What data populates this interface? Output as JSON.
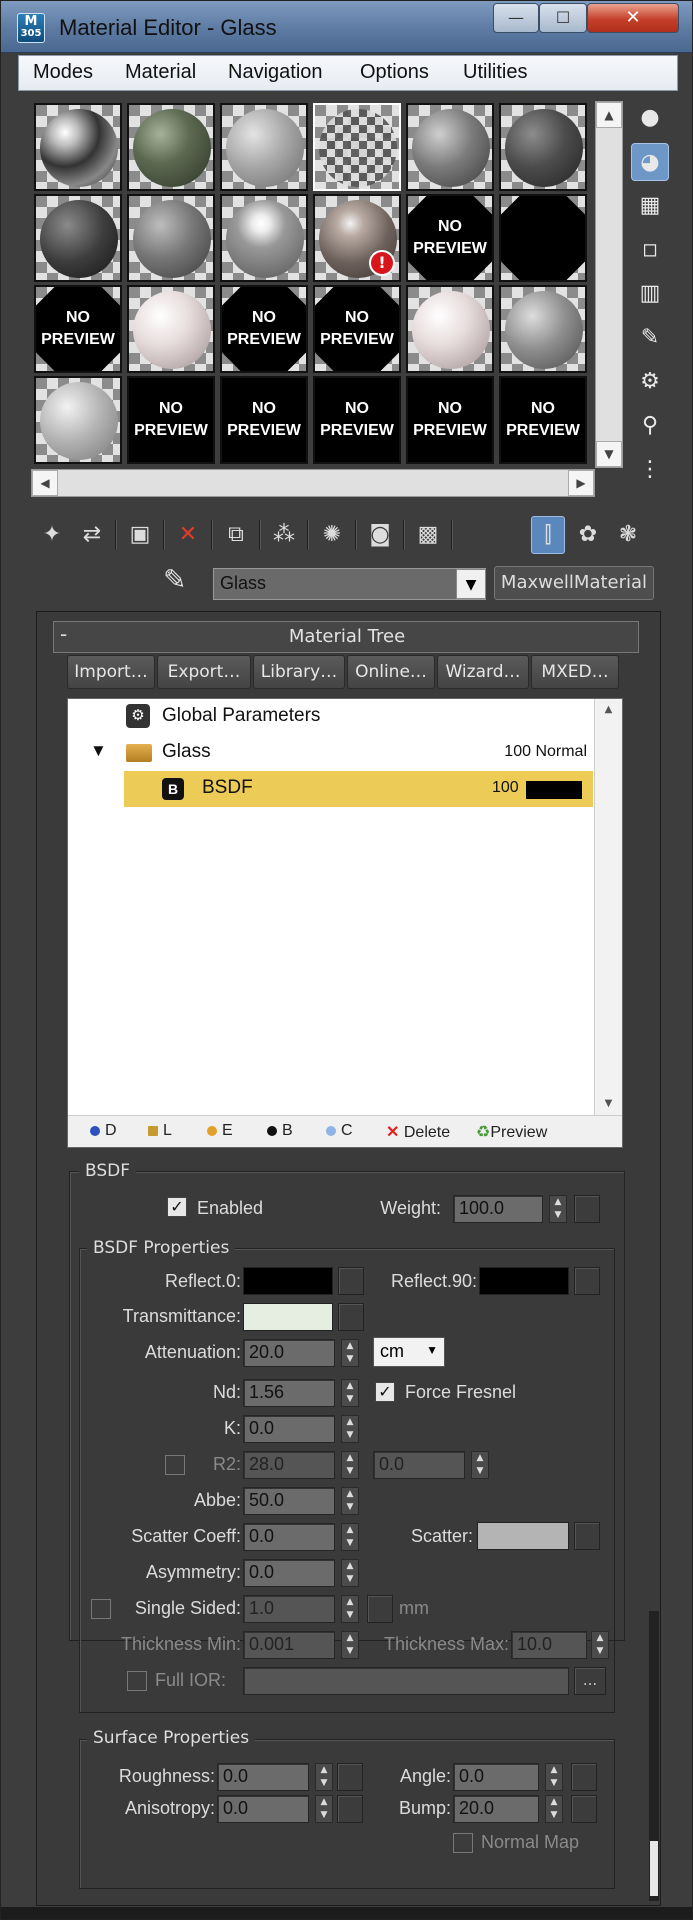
{
  "window": {
    "title": "Material Editor - Glass",
    "icon_text_top": "M",
    "icon_text_bottom": "305",
    "min": "—",
    "max": "☐",
    "close": "✕"
  },
  "menubar": [
    "Modes",
    "Material",
    "Navigation",
    "Options",
    "Utilities"
  ],
  "slots": {
    "no_preview_line1": "NO",
    "no_preview_line2": "PREVIEW",
    "warning_glyph": "!",
    "sample_types": [
      [
        "chrome-sphere",
        "green-sphere",
        "gray-sphere",
        "checker-sphere",
        "speckled-sphere",
        "dark-sphere"
      ],
      [
        "dark-checker-sphere",
        "noise-sphere",
        "checker-sphere",
        "warning-sphere",
        "no-preview-octagon",
        "black-octagon"
      ],
      [
        "no-preview-octagon",
        "map-sphere",
        "no-preview-octagon",
        "no-preview-octagon",
        "map-sphere",
        "noise-sphere"
      ],
      [
        "gray-sphere",
        "no-preview-square",
        "no-preview-square",
        "no-preview-square",
        "no-preview-square",
        "no-preview-square"
      ]
    ]
  },
  "material_selector": {
    "name": "Glass",
    "type_button": "MaxwellMaterial"
  },
  "material_tree": {
    "header": "Material Tree",
    "collapse": "-",
    "buttons": [
      "Import…",
      "Export…",
      "Library…",
      "Online…",
      "Wizard…",
      "MXED…"
    ],
    "rows": [
      {
        "label": "Global Parameters",
        "value": ""
      },
      {
        "label": "Glass",
        "value": "100 Normal",
        "expand": "▼"
      },
      {
        "label": "BSDF",
        "value": "100",
        "badge": "B"
      }
    ],
    "footer": [
      {
        "label": "D",
        "color": "#2d4fbf"
      },
      {
        "label": "L",
        "color": "#c79a2f"
      },
      {
        "label": "E",
        "color": "#e0a02a"
      },
      {
        "label": "B",
        "color": "#111111"
      },
      {
        "label": "C",
        "color": "#8fb3e3"
      }
    ],
    "delete": "Delete",
    "preview": "Preview"
  },
  "bsdf": {
    "group": "BSDF",
    "enabled_label": "Enabled",
    "weight_label": "Weight:",
    "weight": "100.0",
    "properties_group": "BSDF Properties",
    "reflect0_label": "Reflect.0:",
    "reflect90_label": "Reflect.90:",
    "transmittance_label": "Transmittance:",
    "attenuation_label": "Attenuation:",
    "attenuation": "20.0",
    "unit": "cm",
    "nd_label": "Nd:",
    "nd": "1.56",
    "force_fresnel_label": "Force Fresnel",
    "k_label": "K:",
    "k": "0.0",
    "r2_label": "R2:",
    "r2_a": "28.0",
    "r2_b": "0.0",
    "abbe_label": "Abbe:",
    "abbe": "50.0",
    "scatter_coeff_label": "Scatter Coeff:",
    "scatter_coeff": "0.0",
    "scatter_label": "Scatter:",
    "asymmetry_label": "Asymmetry:",
    "asymmetry": "0.0",
    "single_sided_label": "Single Sided:",
    "single_sided": "1.0",
    "mm_label": "mm",
    "thickness_min_label": "Thickness Min:",
    "thickness_min": "0.001",
    "thickness_max_label": "Thickness Max:",
    "thickness_max": "10.0",
    "full_ior_label": "Full IOR:",
    "ellipsis": "..."
  },
  "surface": {
    "group": "Surface Properties",
    "roughness_label": "Roughness:",
    "roughness": "0.0",
    "angle_label": "Angle:",
    "angle": "0.0",
    "anisotropy_label": "Anisotropy:",
    "anisotropy": "0.0",
    "bump_label": "Bump:",
    "bump": "20.0",
    "normal_map_label": "Normal Map"
  },
  "colors": {
    "selection": "#eccb57",
    "reflect0": "#000000",
    "reflect90": "#000000",
    "transmittance": "#e6eee1",
    "scatter": "#b4b4b4",
    "accent": "#5a88bd"
  }
}
